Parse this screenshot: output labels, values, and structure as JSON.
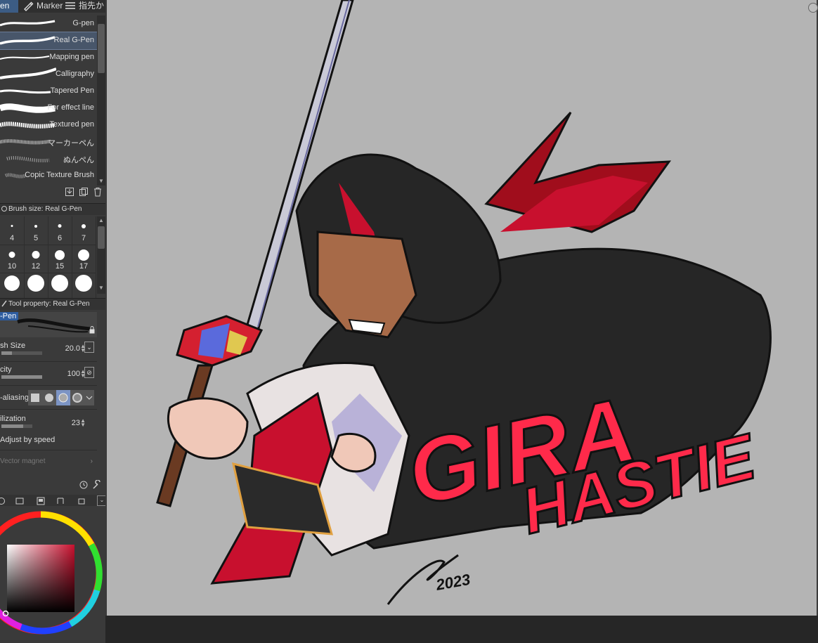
{
  "tabs": [
    {
      "label": "en",
      "active": true
    },
    {
      "label": "Marker",
      "active": false
    },
    {
      "label": "指先か",
      "active": false
    }
  ],
  "brushes": [
    {
      "label": "G-pen",
      "selected": false
    },
    {
      "label": "Real G-Pen",
      "selected": true
    },
    {
      "label": "Mapping pen",
      "selected": false
    },
    {
      "label": "Calligraphy",
      "selected": false
    },
    {
      "label": "Tapered Pen",
      "selected": false
    },
    {
      "label": "For effect line",
      "selected": false
    },
    {
      "label": "Textured pen",
      "selected": false
    },
    {
      "label": "マーカーペん",
      "selected": false
    },
    {
      "label": "ぬんぺん",
      "selected": false
    },
    {
      "label": "Copic Texture Brush",
      "selected": false
    }
  ],
  "brush_size_panel": {
    "title": "Brush size: Real G-Pen",
    "sizes": [
      "4",
      "5",
      "6",
      "7",
      "10",
      "12",
      "15",
      "17"
    ]
  },
  "tool_property": {
    "title": "Tool property: Real G-Pen",
    "preview_name": "-Pen",
    "brush_size_label": "sh Size",
    "brush_size_value": "20.0",
    "brush_size_fraction": 0.25,
    "opacity_label": "city",
    "opacity_value": "100",
    "opacity_fraction": 1.0,
    "antialias_label": "-aliasing",
    "stabilization_label": "ilization",
    "stabilization_value": "23",
    "stabilization_fraction": 0.7,
    "adjust_label": "Adjust by speed",
    "vector_label": "Vector magnet"
  },
  "colors": {
    "accent": "#3c5c84",
    "canvas_bg": "#b4b4b4",
    "ink": "#222222",
    "red": "#c8102e",
    "title_red": "#ff2a4a"
  },
  "artwork": {
    "title_line1": "GIRA",
    "title_line2": "HASTIE",
    "signature_year": "2023"
  }
}
